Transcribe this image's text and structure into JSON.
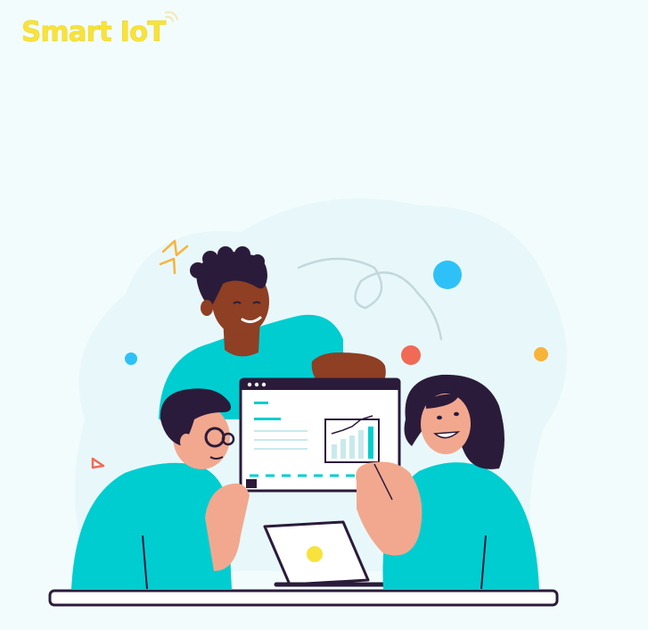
{
  "brand": {
    "name": "Smart IoT"
  },
  "colors": {
    "brand_yellow": "#f7e33b",
    "teal": "#00cdd0",
    "background": "#f3fcfd"
  }
}
